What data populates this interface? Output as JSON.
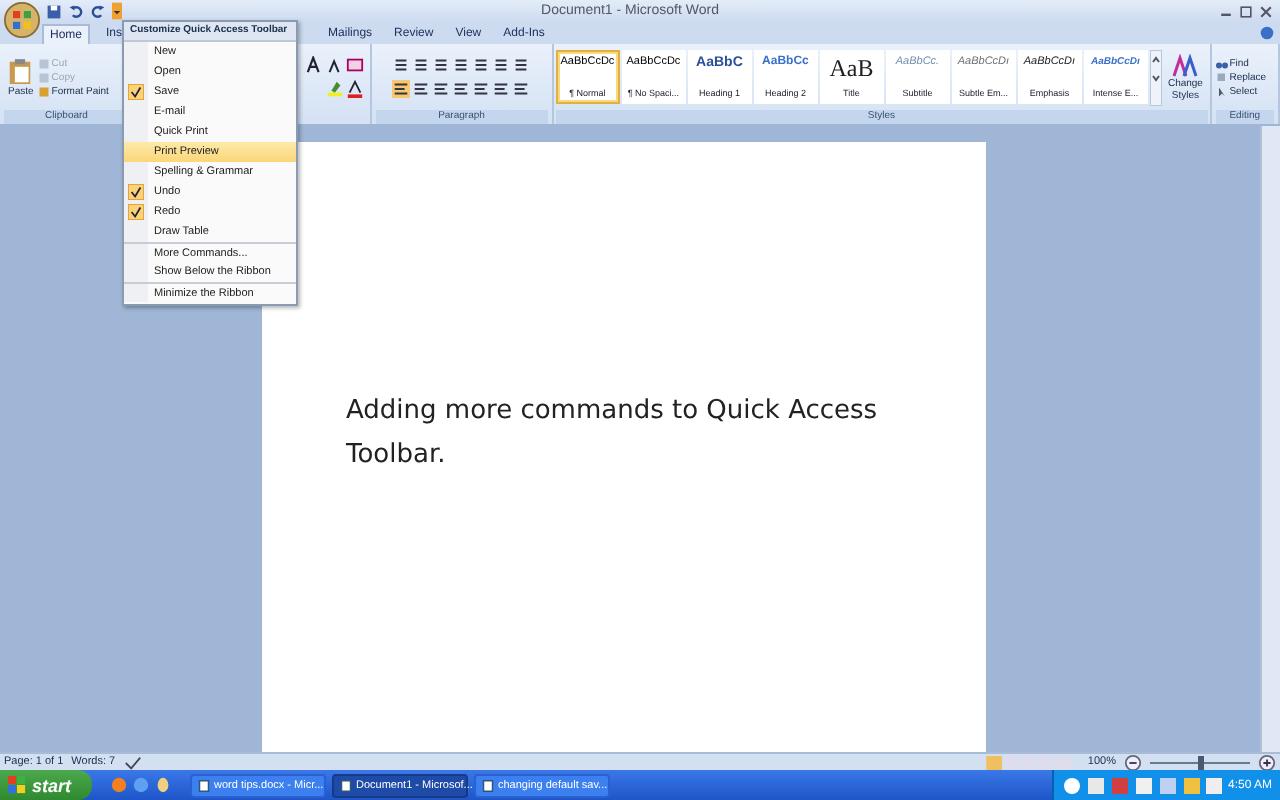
{
  "window": {
    "title": "Document1 - Microsoft Word"
  },
  "tabs": [
    {
      "label": "Home",
      "selected": true
    },
    {
      "label": "Ins",
      "selected": false
    },
    {
      "label": "Mailings",
      "selected": false
    },
    {
      "label": "Review",
      "selected": false
    },
    {
      "label": "View",
      "selected": false
    },
    {
      "label": "Add-Ins",
      "selected": false
    }
  ],
  "ribbon": {
    "clipboard": {
      "label": "Clipboard",
      "paste": "Paste",
      "items": [
        {
          "label": "Cut",
          "disabled": true
        },
        {
          "label": "Copy",
          "disabled": true
        },
        {
          "label": "Format Paint",
          "disabled": false
        }
      ]
    },
    "paragraph": {
      "label": "Paragraph"
    },
    "styles": {
      "label": "Styles",
      "change_styles": "Change Styles",
      "items": [
        {
          "preview": "AaBbCcDc",
          "label": "¶ Normal",
          "kind": "normal",
          "selected": true
        },
        {
          "preview": "AaBbCcDc",
          "label": "¶ No Spaci...",
          "kind": "normal",
          "selected": false
        },
        {
          "preview": "AaBbC",
          "label": "Heading 1",
          "kind": "heading1",
          "selected": false
        },
        {
          "preview": "AaBbCc",
          "label": "Heading 2",
          "kind": "heading2",
          "selected": false
        },
        {
          "preview": "AaB",
          "label": "Title",
          "kind": "title",
          "selected": false
        },
        {
          "preview": "AaBbCc.",
          "label": "Subtitle",
          "kind": "subtitle",
          "selected": false
        },
        {
          "preview": "AaBbCcDı",
          "label": "Subtle Em...",
          "kind": "subtle",
          "selected": false
        },
        {
          "preview": "AaBbCcDı",
          "label": "Emphasis",
          "kind": "emphasis",
          "selected": false
        },
        {
          "preview": "AaBbCcDı",
          "label": "Intense E...",
          "kind": "intense",
          "selected": false
        }
      ]
    },
    "editing": {
      "label": "Editing",
      "find": "Find",
      "replace": "Replace",
      "select": "Select"
    }
  },
  "qat_menu": {
    "title": "Customize Quick Access Toolbar",
    "items": [
      {
        "label": "New",
        "checked": false,
        "selected": false,
        "divider_above": false
      },
      {
        "label": "Open",
        "checked": false,
        "selected": false,
        "divider_above": false
      },
      {
        "label": "Save",
        "checked": true,
        "selected": false,
        "divider_above": false
      },
      {
        "label": "E-mail",
        "checked": false,
        "selected": false,
        "divider_above": false
      },
      {
        "label": "Quick Print",
        "checked": false,
        "selected": false,
        "divider_above": false
      },
      {
        "label": "Print Preview",
        "checked": false,
        "selected": true,
        "divider_above": false
      },
      {
        "label": "Spelling & Grammar",
        "checked": false,
        "selected": false,
        "divider_above": false
      },
      {
        "label": "Undo",
        "checked": true,
        "selected": false,
        "divider_above": false
      },
      {
        "label": "Redo",
        "checked": true,
        "selected": false,
        "divider_above": false
      },
      {
        "label": "Draw Table",
        "checked": false,
        "selected": false,
        "divider_above": false
      },
      {
        "label": "More Commands...",
        "checked": false,
        "selected": false,
        "divider_above": true
      },
      {
        "label": "Show Below the Ribbon",
        "checked": false,
        "selected": false,
        "divider_above": false
      },
      {
        "label": "Minimize the Ribbon",
        "checked": false,
        "selected": false,
        "divider_above": true
      }
    ]
  },
  "document": {
    "text": "Adding more commands to Quick Access Toolbar."
  },
  "status_bar": {
    "page": "Page: 1 of 1",
    "words": "Words: 7",
    "zoom": "100%",
    "zoom_slider": {
      "level": 0.5
    }
  },
  "taskbar": {
    "start": "start",
    "tasks": [
      {
        "label": "word tips.docx - Micr...",
        "selected": false
      },
      {
        "label": "Document1 - Microsof...",
        "selected": true
      },
      {
        "label": "changing default sav...",
        "selected": false
      }
    ],
    "clock": "4:50 AM"
  }
}
